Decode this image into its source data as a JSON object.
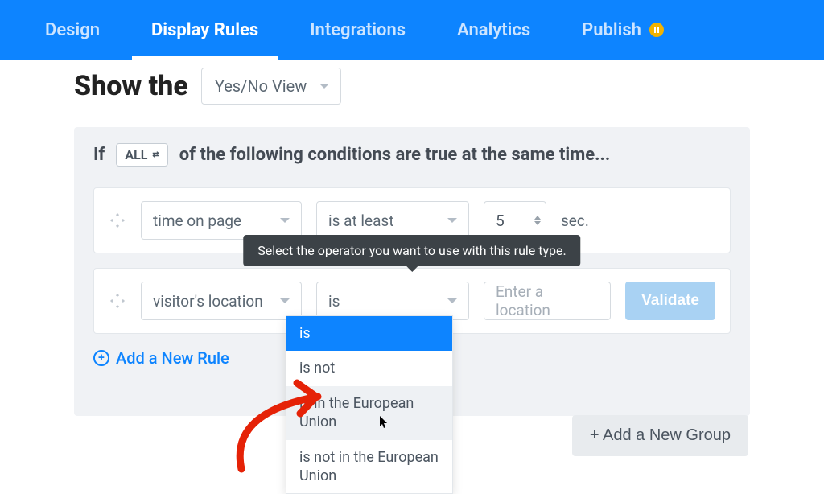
{
  "nav": {
    "items": [
      {
        "label": "Design"
      },
      {
        "label": "Display Rules"
      },
      {
        "label": "Integrations"
      },
      {
        "label": "Analytics"
      },
      {
        "label": "Publish"
      }
    ]
  },
  "header": {
    "title": "Show the",
    "view_selected": "Yes/No View"
  },
  "group": {
    "prefix": "If",
    "mode": "ALL",
    "suffix": "of the following conditions are true at the same time..."
  },
  "rules": [
    {
      "type": "time on page",
      "operator": "is at least",
      "value": "5",
      "unit": "sec."
    },
    {
      "type": "visitor's location",
      "operator": "is",
      "location_placeholder": "Enter a location",
      "validate_label": "Validate"
    }
  ],
  "tooltip": "Select the operator you want to use with this rule type.",
  "operator_options": [
    "is",
    "is not",
    "is in the European Union",
    "is not in the European Union"
  ],
  "actions": {
    "add_rule": "Add a New Rule",
    "add_group": "+ Add a New Group"
  }
}
